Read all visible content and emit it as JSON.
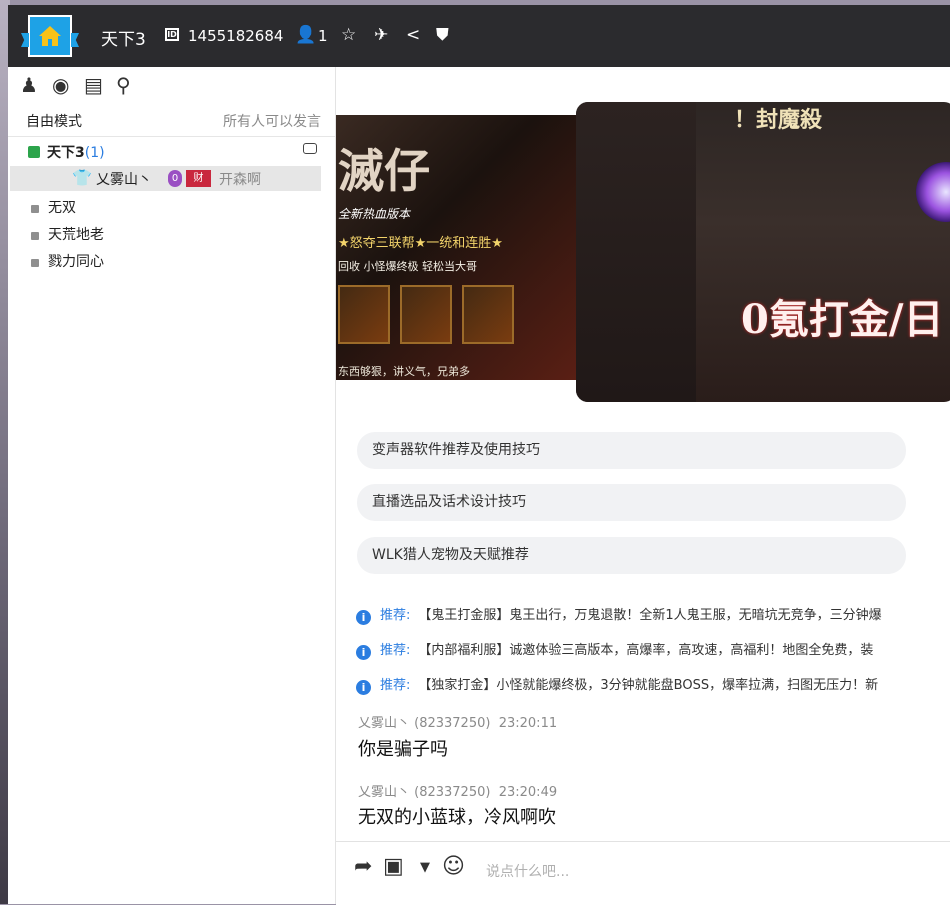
{
  "colors": {
    "accent": "#2b7de0",
    "topbar": "#2b2b2e",
    "home": "#1ea2e6"
  },
  "topbar": {
    "title": "天下3",
    "id": "1455182684",
    "member_count": "1"
  },
  "sidebar": {
    "mode": "自由模式",
    "mode_desc": "所有人可以发言",
    "channels": [
      {
        "name": "天下3",
        "count": "(1)"
      },
      {
        "name": "无双"
      },
      {
        "name": "天荒地老"
      },
      {
        "name": "戮力同心"
      }
    ],
    "member": {
      "name": "乂雾山丶",
      "badge1": "0",
      "badge2": "财",
      "status": "开森啊"
    }
  },
  "banner": {
    "title": "滅仔",
    "subtitle": "全新热血版本",
    "slogan": "★怒夺三联帮★一统和连胜★",
    "small": "回收 小怪爆终极 轻松当大哥",
    "foot": "东西够狠，讲义气，兄弟多",
    "b2_title": "！封魔殺",
    "b2_big": "0氪打金/日"
  },
  "suggestions": [
    "变声器软件推荐及使用技巧",
    "直播选品及话术设计技巧",
    "WLK猎人宠物及天赋推荐"
  ],
  "recommendations": [
    {
      "label": "推荐:",
      "text": "【鬼王打金服】鬼王出行，万鬼退散！全新1人鬼王服，无暗坑无竞争，三分钟爆"
    },
    {
      "label": "推荐:",
      "text": "【内部福利服】诚邀体验三高版本，高爆率，高攻速，高福利！地图全免费，装"
    },
    {
      "label": "推荐:",
      "text": "【独家打金】小怪就能爆终极，3分钟就能盘BOSS，爆率拉满，扫图无压力！新"
    }
  ],
  "messages": [
    {
      "author": "乂雾山丶 (82337250)",
      "time": "23:20:11",
      "text": "你是骗子吗"
    },
    {
      "author": "乂雾山丶 (82337250)",
      "time": "23:20:49",
      "text": "无双的小蓝球，冷风啊吹"
    }
  ],
  "input": {
    "placeholder": "说点什么吧..."
  }
}
